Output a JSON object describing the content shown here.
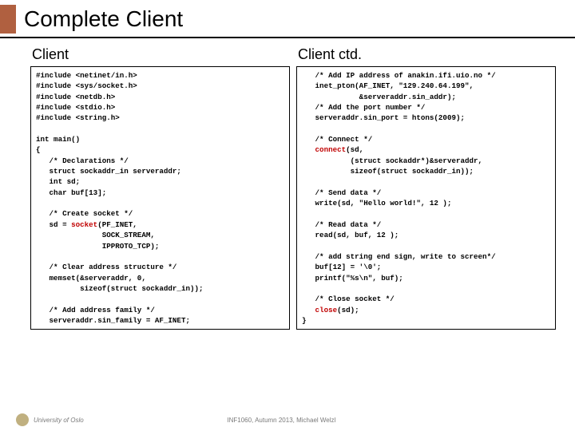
{
  "title": "Complete Client",
  "left": {
    "heading": "Client",
    "includes": [
      "#include <netinet/in.h>",
      "#include <sys/socket.h>",
      "#include <netdb.h>",
      "#include <stdio.h>",
      "#include <string.h>"
    ],
    "main_open": "int main()\n{",
    "decl_comment": "   /* Declarations */",
    "decl1": "   struct sockaddr_in serveraddr;",
    "decl2": "   int sd;",
    "decl3": "   char buf[13];",
    "create_comment": "   /* Create socket */",
    "create_assign_pre": "   sd = ",
    "socket_fn": "socket",
    "create_assign_post": "(PF_INET,",
    "create_l2": "               SOCK_STREAM,",
    "create_l3": "               IPPROTO_TCP);",
    "clear_comment": "   /* Clear address structure */",
    "clear_l1": "   memset(&serveraddr, 0,",
    "clear_l2": "          sizeof(struct sockaddr_in));",
    "fam_comment": "   /* Add address family */",
    "fam_l1": "   serveraddr.sin_family = AF_INET;"
  },
  "right": {
    "heading": "Client ctd.",
    "ip_comment": "   /* Add IP address of anakin.ifi.uio.no */",
    "ip_l1": "   inet_pton(AF_INET, \"129.240.64.199\",",
    "ip_l2": "             &serveraddr.sin_addr);",
    "port_comment": "   /* Add the port number */",
    "port_l1": "   serveraddr.sin_port = htons(2009);",
    "conn_comment": "   /* Connect */",
    "connect_fn": "connect",
    "conn_l1_post": "(sd,",
    "conn_l2": "           (struct sockaddr*)&serveraddr,",
    "conn_l3": "           sizeof(struct sockaddr_in));",
    "send_comment": "   /* Send data */",
    "send_l1": "   write(sd, \"Hello world!\", 12 );",
    "read_comment": "   /* Read data */",
    "read_l1": "   read(sd, buf, 12 );",
    "end_comment": "   /* add string end sign, write to screen*/",
    "end_l1": "   buf[12] = '\\0';",
    "end_l2": "   printf(\"%s\\n\", buf);",
    "close_comment": "   /* Close socket */",
    "close_fn": "close",
    "close_post": "(sd);",
    "brace": "}"
  },
  "footer": {
    "uni": "University of Oslo",
    "mid": "INF1060, Autumn 2013, Michael Welzl"
  }
}
